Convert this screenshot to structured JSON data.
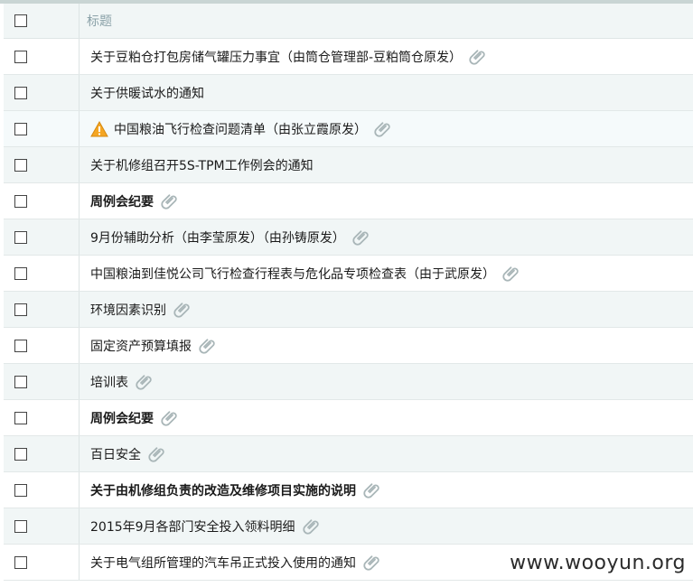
{
  "header": {
    "title_label": "标题"
  },
  "rows": [
    {
      "title": "关于豆粕仓打包房储气罐压力事宜（由筒仓管理部-豆粕筒仓原发）",
      "bold": false,
      "attachment": true,
      "warning": false
    },
    {
      "title": "关于供暖试水的通知",
      "bold": false,
      "attachment": false,
      "warning": false
    },
    {
      "title": "中国粮油飞行检查问题清单（由张立霞原发）",
      "bold": false,
      "attachment": true,
      "warning": true
    },
    {
      "title": "关于机修组召开5S-TPM工作例会的通知",
      "bold": false,
      "attachment": false,
      "warning": false
    },
    {
      "title": "周例会纪要",
      "bold": true,
      "attachment": true,
      "warning": false
    },
    {
      "title": "9月份辅助分析（由李莹原发）（由孙铸原发）",
      "bold": false,
      "attachment": true,
      "warning": false
    },
    {
      "title": "中国粮油到佳悦公司飞行检查行程表与危化品专项检查表（由于武原发）",
      "bold": false,
      "attachment": true,
      "warning": false
    },
    {
      "title": "环境因素识别",
      "bold": false,
      "attachment": true,
      "warning": false
    },
    {
      "title": "固定资产预算填报",
      "bold": false,
      "attachment": true,
      "warning": false
    },
    {
      "title": "培训表",
      "bold": false,
      "attachment": true,
      "warning": false
    },
    {
      "title": "周例会纪要",
      "bold": true,
      "attachment": true,
      "warning": false
    },
    {
      "title": "百日安全",
      "bold": false,
      "attachment": true,
      "warning": false
    },
    {
      "title": "关于由机修组负责的改造及维修项目实施的说明",
      "bold": true,
      "attachment": true,
      "warning": false
    },
    {
      "title": "2015年9月各部门安全投入领料明细",
      "bold": false,
      "attachment": true,
      "warning": false
    },
    {
      "title": "关于电气组所管理的汽车吊正式投入使用的通知",
      "bold": false,
      "attachment": true,
      "warning": false
    }
  ],
  "icons": {
    "attachment": "paperclip-icon",
    "warning": "warning-icon"
  },
  "colors": {
    "header_text": "#8aa1a8",
    "warning": "#f5a623",
    "clip": "#a9b6b8"
  },
  "watermark": "www.wooyun.org"
}
